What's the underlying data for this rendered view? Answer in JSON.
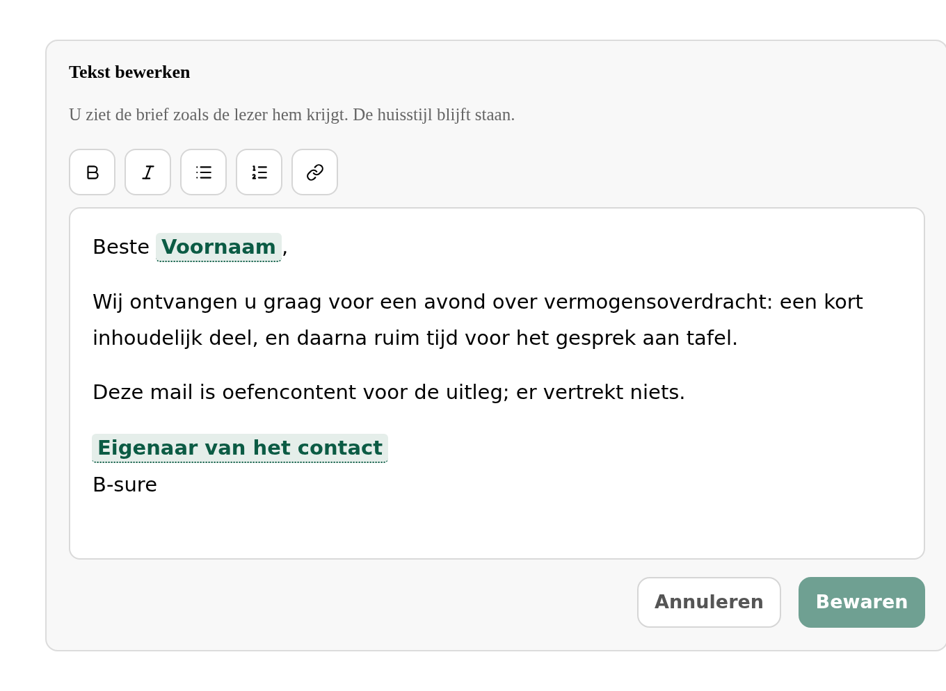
{
  "dialog": {
    "title": "Tekst bewerken",
    "subtitle": "U ziet de brief zoals de lezer hem krijgt. De huisstijl blijft staan."
  },
  "toolbar": [
    {
      "kind": "bold"
    },
    {
      "kind": "italic"
    },
    {
      "kind": "bullet-list"
    },
    {
      "kind": "numbered-list"
    },
    {
      "kind": "link"
    }
  ],
  "editor": {
    "blocks": [
      {
        "kind": "greeting",
        "text_before": "Beste",
        "field": "Voornaam",
        "text_after": ","
      },
      {
        "kind": "paragraph",
        "text": "Wij ontvangen u graag voor een avond over vermogensoverdracht: een kort inhoudelijk deel, en daarna ruim tijd voor het gesprek aan tafel."
      },
      {
        "kind": "paragraph",
        "text": "Deze mail is oefencontent voor de uitleg; er vertrekt niets."
      },
      {
        "kind": "signature",
        "field": "Eigenaar van het contact",
        "text": "B-sure"
      }
    ]
  },
  "buttons": [
    {
      "label": "Annuleren",
      "kind": "secondary"
    },
    {
      "label": "Bewaren",
      "kind": "primary"
    }
  ]
}
